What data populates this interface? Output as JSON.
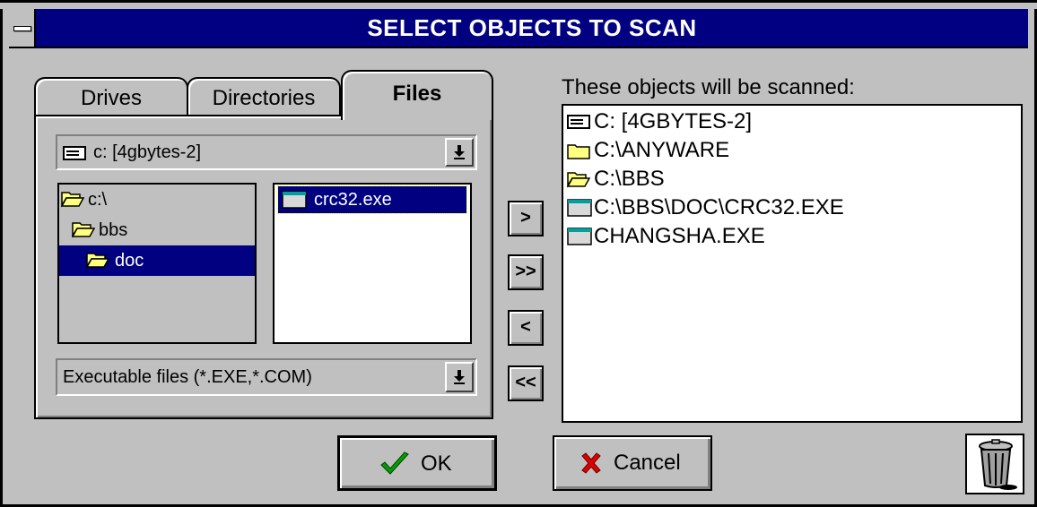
{
  "window": {
    "title": "SELECT OBJECTS TO SCAN",
    "title_bar_color": "#000080",
    "face_color": "#c0c0c0"
  },
  "tabs": [
    {
      "label": "Drives",
      "active": false
    },
    {
      "label": "Directories",
      "active": false
    },
    {
      "label": "Files",
      "active": true
    }
  ],
  "drive_combo": {
    "icon": "drive-icon",
    "value": "c: [4gbytes-2]"
  },
  "dir_list": [
    {
      "label": "c:\\",
      "icon": "open-folder-icon",
      "selected": false
    },
    {
      "label": "bbs",
      "icon": "open-folder-icon",
      "selected": false
    },
    {
      "label": "doc",
      "icon": "open-folder-icon",
      "selected": true
    }
  ],
  "file_list": [
    {
      "label": "crc32.exe",
      "icon": "executable-icon",
      "selected": true
    }
  ],
  "filter_combo": {
    "value": "Executable files (*.EXE,*.COM)"
  },
  "move_buttons": {
    "add": ">",
    "add_all": ">>",
    "remove": "<",
    "remove_all": "<<"
  },
  "scan_panel": {
    "label": "These objects will be scanned:",
    "items": [
      {
        "label": "C: [4GBYTES-2]",
        "icon": "drive-icon"
      },
      {
        "label": "C:\\ANYWARE",
        "icon": "folder-icon"
      },
      {
        "label": "C:\\BBS",
        "icon": "open-folder-icon"
      },
      {
        "label": "C:\\BBS\\DOC\\CRC32.EXE",
        "icon": "executable-icon"
      },
      {
        "label": "CHANGSHA.EXE",
        "icon": "executable-icon"
      }
    ]
  },
  "buttons": {
    "ok": "OK",
    "cancel": "Cancel"
  },
  "colors": {
    "selection": "#000080",
    "ok_check": "#00a000",
    "cancel_x": "#e00000",
    "folder": "#ffff80"
  }
}
